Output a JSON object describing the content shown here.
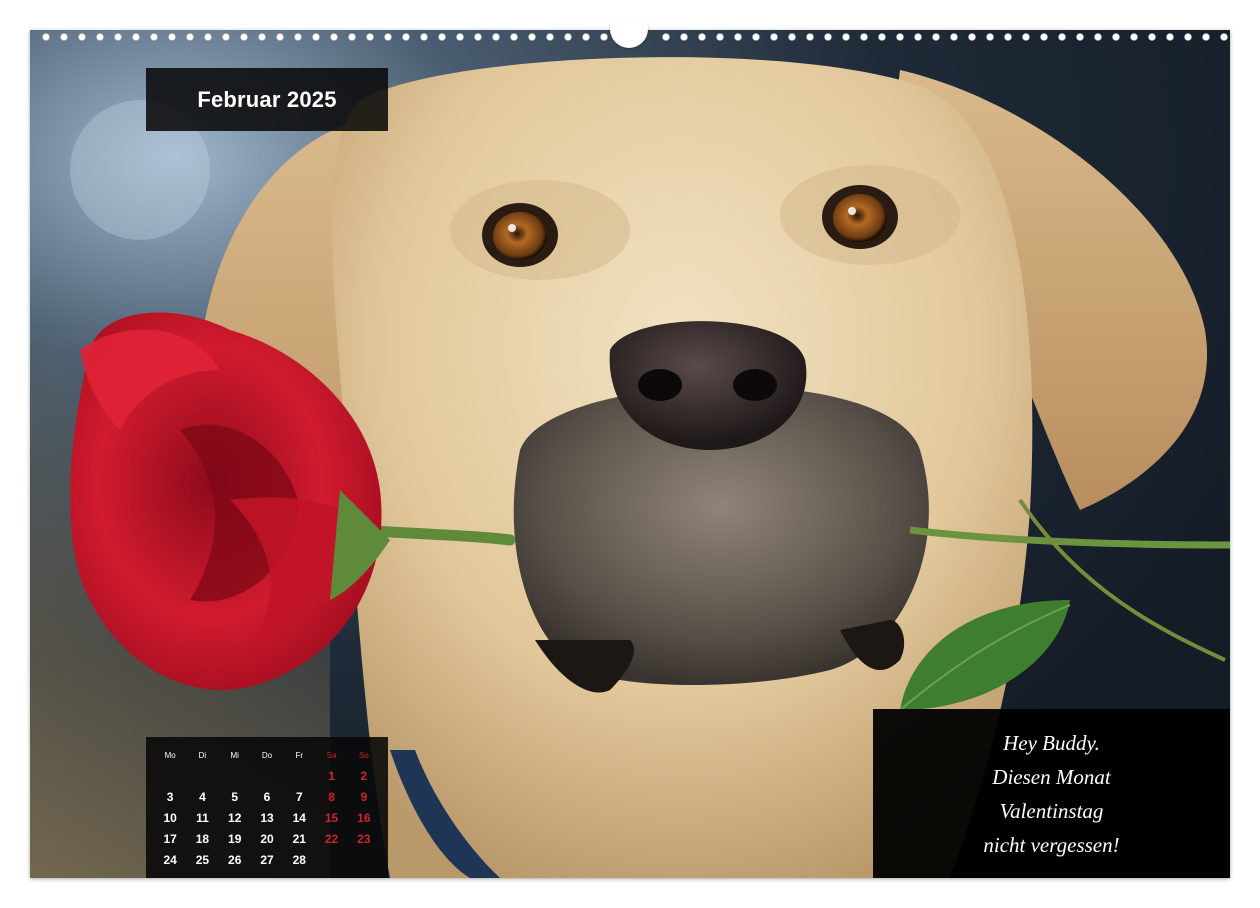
{
  "calendar": {
    "month_title": "Februar 2025",
    "weekdays": [
      "Mo",
      "Di",
      "Mi",
      "Do",
      "Fr",
      "Sa",
      "So"
    ],
    "weeks": [
      [
        "",
        "",
        "",
        "",
        "",
        "1",
        "2"
      ],
      [
        "3",
        "4",
        "5",
        "6",
        "7",
        "8",
        "9"
      ],
      [
        "10",
        "11",
        "12",
        "13",
        "14",
        "15",
        "16"
      ],
      [
        "17",
        "18",
        "19",
        "20",
        "21",
        "22",
        "23"
      ],
      [
        "24",
        "25",
        "26",
        "27",
        "28",
        "",
        ""
      ]
    ]
  },
  "message": {
    "lines": [
      "Hey Buddy.",
      "Diesen Monat",
      "Valentinstag",
      "nicht vergessen!"
    ]
  },
  "photo": {
    "subject": "labrador-with-red-rose",
    "icons": [
      "dog-icon",
      "rose-icon",
      "binding-ring-icon"
    ]
  },
  "colors": {
    "weekend": "#d2232a",
    "panel": "#0a0a0a",
    "rose": "#c8102e",
    "dog_fur": "#e6cfa6"
  }
}
